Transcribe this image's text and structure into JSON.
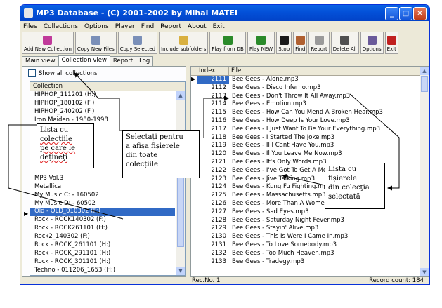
{
  "window": {
    "title": "MP3 Database - (C) 2001-2002 by Mihai MATEI",
    "controls": [
      "_",
      "□",
      "✕"
    ]
  },
  "menu": [
    "Files",
    "Collections",
    "Options",
    "Player",
    "Find",
    "Report",
    "About",
    "Exit"
  ],
  "toolbar": [
    {
      "label": "Add New Collection",
      "icon": "collection-add-icon",
      "color": "#c03a9a"
    },
    {
      "label": "Copy New Files",
      "icon": "copy-files-icon",
      "color": "#7a8fb8"
    },
    {
      "label": "Copy Selected",
      "icon": "copy-selected-icon",
      "color": "#7a8fb8"
    },
    {
      "label": "Include subfolders",
      "icon": "subfolders-icon",
      "color": "#d9b040"
    },
    {
      "label": "Play from DB",
      "icon": "play-icon",
      "color": "#2a8a2a"
    },
    {
      "label": "Play NEW",
      "icon": "play-new-icon",
      "color": "#2a8a2a"
    },
    {
      "label": "Stop",
      "icon": "stop-icon",
      "color": "#1a1a1a"
    },
    {
      "label": "Find",
      "icon": "find-icon",
      "color": "#b06030"
    },
    {
      "label": "Report",
      "icon": "report-icon",
      "color": "#9a9a9a"
    },
    {
      "label": "Delete All",
      "icon": "trash-icon",
      "color": "#505050"
    },
    {
      "label": "Options",
      "icon": "options-icon",
      "color": "#6a5a9a"
    },
    {
      "label": "Exit",
      "icon": "exit-icon",
      "color": "#c02020"
    }
  ],
  "tabs": [
    "Main view",
    "Collection view",
    "Report",
    "Log"
  ],
  "left": {
    "show_all_label": "Show all collections",
    "header": "Collection",
    "items": [
      "HIPHOP_111201 (H:)",
      "HIPHOP_180102 (F:)",
      "HIPHOP_240202 (F:)",
      "Iron Maiden - 1980-1998",
      "",
      "",
      "",
      "",
      "",
      "",
      "MP3 Vol.3",
      "Metallica",
      "My Music C: - 160502",
      "My Music D: - 60502",
      "Old - OLD_010302 (F:)",
      "Rock - ROCK140302 (F:)",
      "Rock - ROCK261101 (H:)",
      "Rock2_140302 (F:)",
      "Rock - ROCK_261101 (H:)",
      "Rock - ROCK_291101 (H:)",
      "Rock - ROCK_301101 (H:)",
      "Techno - 011206_1653 (H:)"
    ],
    "selected_index": 14
  },
  "grid": {
    "col_index": "Index",
    "col_file": "File",
    "rows": [
      {
        "idx": "2111",
        "file": "Bee Gees - Alone.mp3"
      },
      {
        "idx": "2112",
        "file": "Bee Gees - Disco Inferno.mp3"
      },
      {
        "idx": "2113",
        "file": "Bee Gees - Don't Throw It All Away.mp3"
      },
      {
        "idx": "2114",
        "file": "Bee Gees - Emotion.mp3"
      },
      {
        "idx": "2115",
        "file": "Bee Gees - How Can You Mend A Broken Hear.mp3"
      },
      {
        "idx": "2116",
        "file": "Bee Gees - How Deep Is Your Love.mp3"
      },
      {
        "idx": "2117",
        "file": "Bee Gees - I Just Want To Be Your Everything.mp3"
      },
      {
        "idx": "2118",
        "file": "Bee Gees - I Started The Joke.mp3"
      },
      {
        "idx": "2119",
        "file": "Bee Gees - Il I Cant Have You.mp3"
      },
      {
        "idx": "2120",
        "file": "Bee Gees - Il You Leave Me Now.mp3"
      },
      {
        "idx": "2121",
        "file": "Bee Gees - It's Only Words.mp3"
      },
      {
        "idx": "2122",
        "file": "Bee Gees - I've Got To Get A Message"
      },
      {
        "idx": "2123",
        "file": "Bee Gees - Jive Talking.mp3"
      },
      {
        "idx": "2124",
        "file": "Bee Gees - Kung Fu Fighting.mp3"
      },
      {
        "idx": "2125",
        "file": "Bee Gees - Massachusetts.mp3"
      },
      {
        "idx": "2126",
        "file": "Bee Gees - More Than A Women.mp3"
      },
      {
        "idx": "2127",
        "file": "Bee Gees - Sad Eyes.mp3"
      },
      {
        "idx": "2128",
        "file": "Bee Gees - Saturday Night Fever.mp3"
      },
      {
        "idx": "2129",
        "file": "Bee Gees - Stayin' Alive.mp3"
      },
      {
        "idx": "2130",
        "file": "Bee Gees - This Is Were I Came In.mp3"
      },
      {
        "idx": "2131",
        "file": "Bee Gees - To Love Somebody.mp3"
      },
      {
        "idx": "2132",
        "file": "Bee Gees - Too Much Heaven.mp3"
      },
      {
        "idx": "2133",
        "file": "Bee Gees - Tradegy.mp3"
      }
    ],
    "selected_index": 0
  },
  "status": {
    "recno": "Rec.No. 1",
    "count": "Record count: 184"
  },
  "callouts": {
    "c1_line1": "Lista cu",
    "c1_line2": "colecțiile",
    "c1_line3": "pe care le",
    "c1_line4": "deţineţi",
    "c2_line1": "Selectați pentru",
    "c2_line2": "a afişa fișierele",
    "c2_line3": "din toate",
    "c2_line4": "colecțiile",
    "c3_line1": "Lista cu",
    "c3_line2": "fișierele",
    "c3_line3": "din colecţia",
    "c3_line4": "selectată"
  },
  "colors": {
    "selection": "#316ac5",
    "titlebar": "#0350d8",
    "face": "#ece9d8"
  }
}
